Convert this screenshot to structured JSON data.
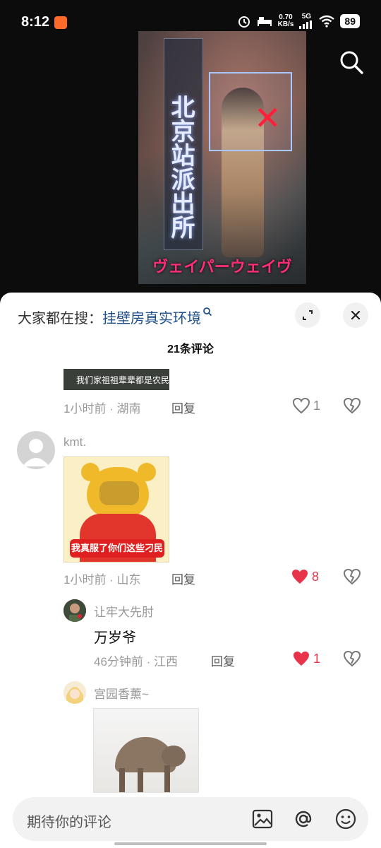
{
  "status_bar": {
    "time": "8:12",
    "net_speed_value": "0.70",
    "net_speed_unit": "KB/s",
    "signal": "5G",
    "battery": "89"
  },
  "video": {
    "sign_text": "北京站派出所",
    "caption": "ヴェイパーウェイヴ"
  },
  "sheet": {
    "hot_search_label": "大家都在搜：",
    "hot_search_keyword": "挂壁房真实环境",
    "comment_count": "21条评论",
    "input_placeholder": "期待你的评论"
  },
  "comments": [
    {
      "image_caption": "我们家祖祖辈辈都是农民穷怕",
      "meta": "1小时前 · 湖南",
      "reply_label": "回复",
      "likes": "1",
      "liked": false
    },
    {
      "username": "kmt.",
      "image_caption": "我真服了你们这些刁民",
      "meta": "1小时前 · 山东",
      "reply_label": "回复",
      "likes": "8",
      "liked": true
    },
    {
      "username": "让牢大先肘",
      "text": "万岁爷",
      "meta": "46分钟前 · 江西",
      "reply_label": "回复",
      "likes": "1",
      "liked": true
    },
    {
      "username": "宫园香薰~"
    }
  ],
  "colors": {
    "accent_red": "#e8334a",
    "keyword_blue": "#1f4f8a"
  }
}
